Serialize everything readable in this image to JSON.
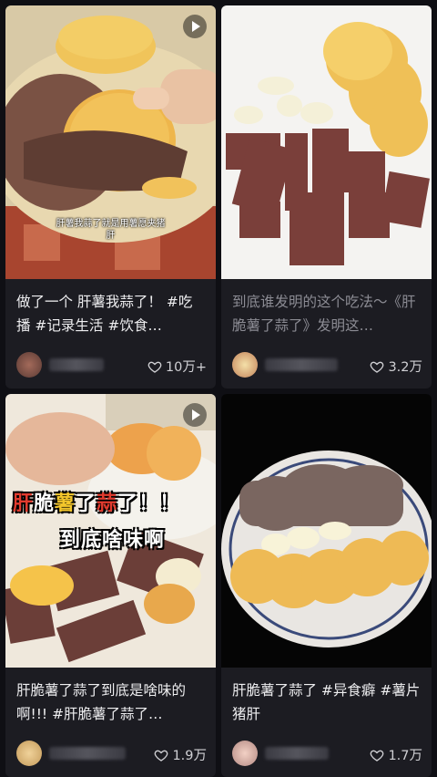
{
  "cards": [
    {
      "overlay_caption": "肝薯我蒜了就是用薯愿夹猪肝",
      "title": "做了一个 肝薯我蒜了！ #吃播 #记录生活 #饮食…",
      "likes": "10万+",
      "has_play_icon": true
    },
    {
      "title": "到底谁发明的这个吃法～《肝脆薯了蒜了》发明这…",
      "likes": "3.2万",
      "has_play_icon": false
    },
    {
      "overlay_text_1": "肝脆薯了蒜了！！",
      "overlay_text_2": "到底啥味啊",
      "title": "肝脆薯了蒜了到底是啥味的啊!!! #肝脆薯了蒜了…",
      "likes": "1.9万",
      "has_play_icon": true
    },
    {
      "title": "肝脆薯了蒜了 #异食癖 #薯片猪肝",
      "likes": "1.7万",
      "has_play_icon": false
    }
  ],
  "colors": {
    "background": "#0f0f14",
    "card": "#1c1c22",
    "chip": "#e9b84a",
    "liver": "#6b4a3e",
    "red_text": "#e23b2e",
    "yellow_text": "#f3c62b"
  }
}
